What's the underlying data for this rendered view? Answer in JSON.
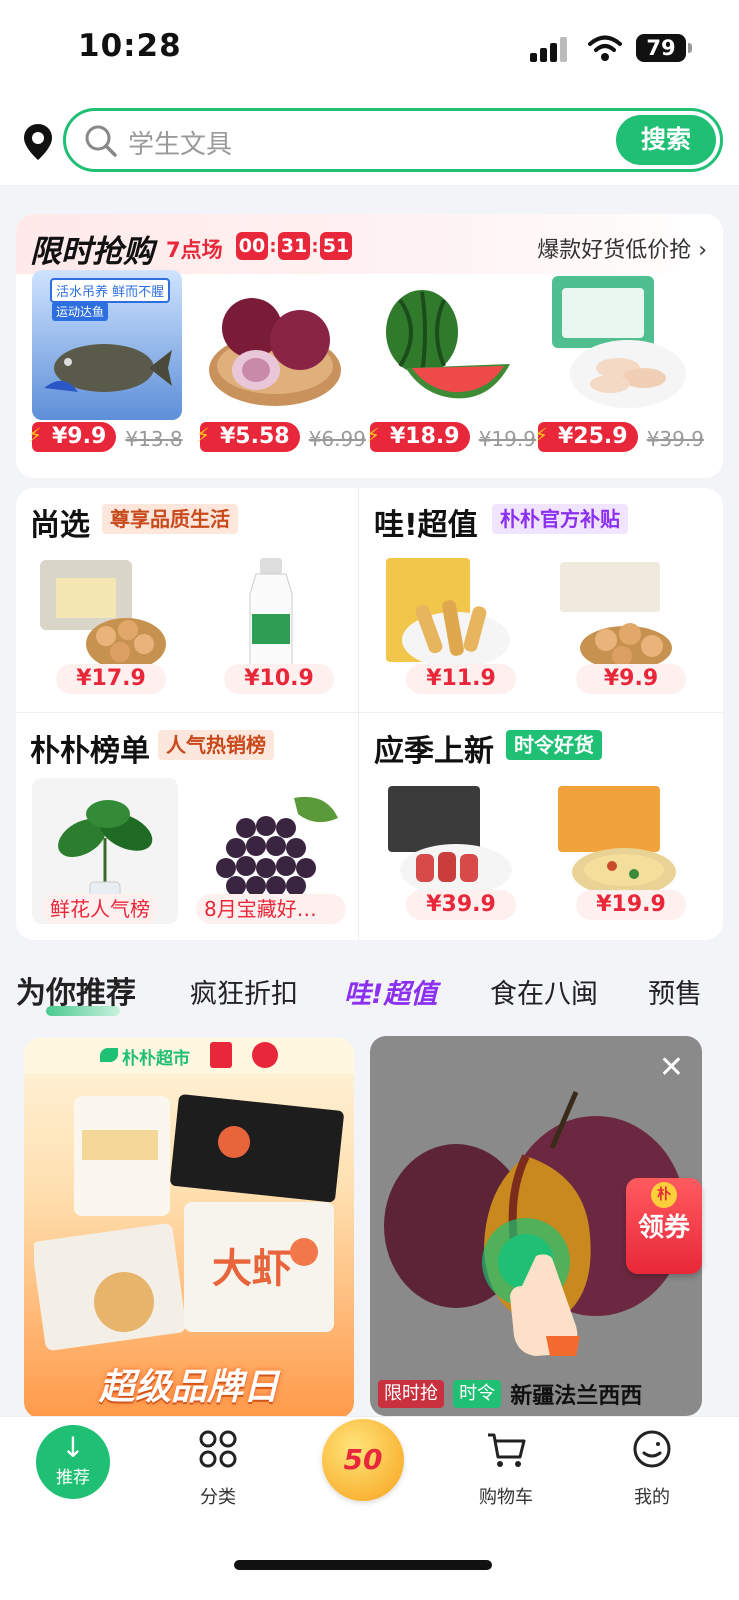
{
  "status": {
    "time": "10:28",
    "battery": "79"
  },
  "search": {
    "placeholder": "学生文具",
    "button": "搜索"
  },
  "flash": {
    "title": "限时抢购",
    "session": "7点场",
    "timer": [
      "00",
      "31",
      "51"
    ],
    "more": "爆款好货低价抢 ›",
    "items": [
      {
        "price": "¥9.9",
        "old": "¥13.8",
        "img_text": "活水吊养 鲜而不腥",
        "img_sub": "运动达鱼"
      },
      {
        "price": "¥5.58",
        "old": "¥6.99"
      },
      {
        "price": "¥18.9",
        "old": "¥19.9"
      },
      {
        "price": "¥25.9",
        "old": "¥39.9"
      }
    ]
  },
  "grid": {
    "cells": [
      {
        "title": "尚选",
        "badge": "尊享品质生活",
        "badge_bg": "#fde7dc",
        "badge_color": "#c84a1c",
        "prices": [
          "¥17.9",
          "¥10.9"
        ]
      },
      {
        "title": "哇!超值",
        "badge": "朴朴官方补贴",
        "badge_bg": "#f0e4ff",
        "badge_color": "#8b2ff0",
        "prices": [
          "¥11.9",
          "¥9.9"
        ]
      },
      {
        "title": "朴朴榜单",
        "badge": "人气热销榜",
        "badge_bg": "#fde7dc",
        "badge_color": "#c84a1c",
        "labels": [
          "鲜花人气榜",
          "8月宝藏好…"
        ]
      },
      {
        "title": "应季上新",
        "badge": "时令好货",
        "badge_bg": "#1fbf74",
        "badge_color": "#ffffff",
        "prices": [
          "¥39.9",
          "¥19.9"
        ]
      }
    ]
  },
  "rec_tabs": [
    "为你推荐",
    "疯狂折扣",
    "哇!超值",
    "食在八闽",
    "预售"
  ],
  "feed": {
    "banner_brand": "朴朴超市",
    "banner_caption": "超级品牌日",
    "ad_tags": [
      "限时抢",
      "时令"
    ],
    "ad_title": "新疆法兰西西",
    "close": "✕"
  },
  "coupon": {
    "label": "领券",
    "dot": "朴"
  },
  "tabbar": {
    "home": "推荐",
    "items": [
      "分类",
      "购物车",
      "我的"
    ],
    "center": "50"
  },
  "colors": {
    "accent": "#1fbf74",
    "price_red": "#e8283a",
    "purple": "#8b2ff0"
  }
}
